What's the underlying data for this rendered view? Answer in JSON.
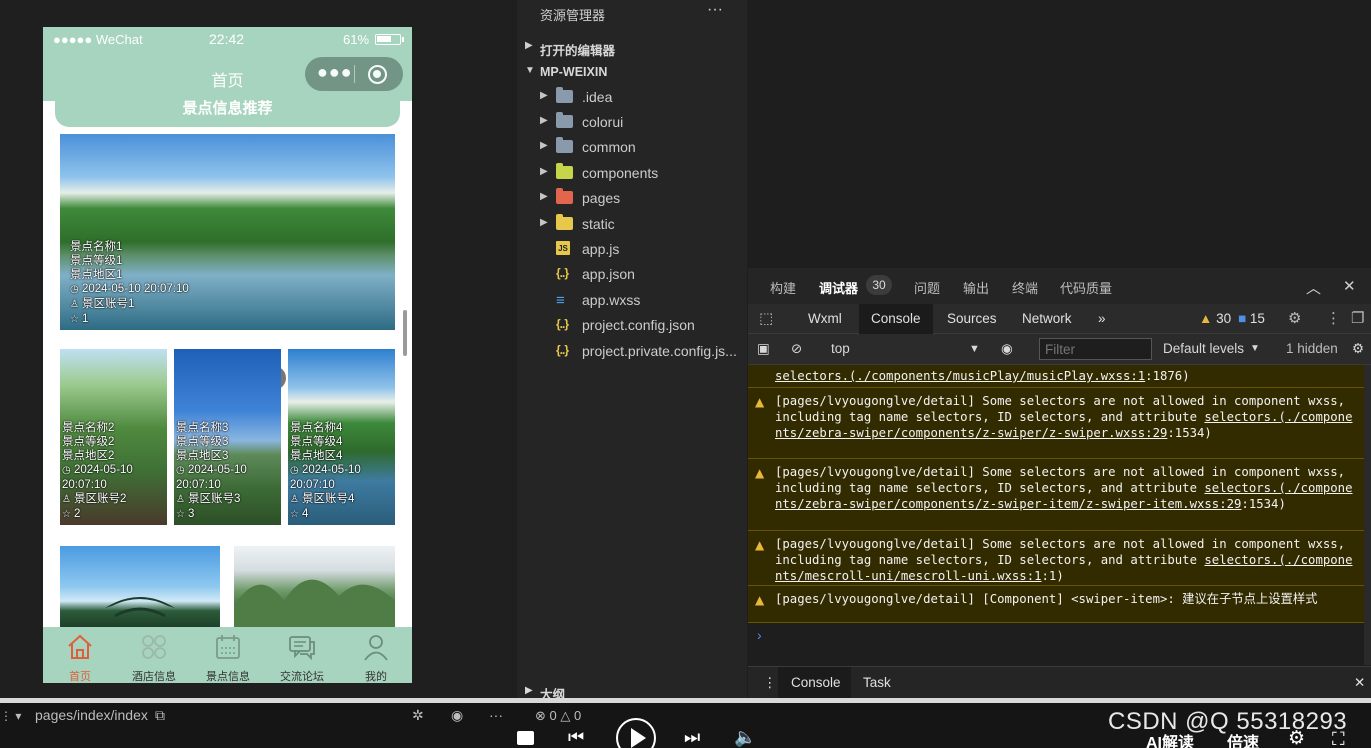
{
  "simulator": {
    "status_bar": {
      "carrier": "●●●●● WeChat",
      "time": "22:42",
      "battery": "61%"
    },
    "nav_title": "首页",
    "section_title": "景点信息推荐",
    "featured": {
      "name": "景点名称1",
      "level": "景点等级1",
      "region": "景点地区1",
      "datetime": "2024-05-10 20:07:10",
      "account": "景区账号1",
      "stars": "1"
    },
    "cards": [
      {
        "name": "景点名称2",
        "level": "景点等级2",
        "region": "景点地区2",
        "date": "2024-05-10",
        "time": "20:07:10",
        "account": "景区账号2",
        "stars": "2"
      },
      {
        "name": "景点名称3",
        "level": "景点等级3",
        "region": "景点地区3",
        "date": "2024-05-10",
        "time": "20:07:10",
        "account": "景区账号3",
        "stars": "3"
      },
      {
        "name": "景点名称4",
        "level": "景点等级4",
        "region": "景点地区4",
        "date": "2024-05-10",
        "time": "20:07:10",
        "account": "景区账号4",
        "stars": "4"
      }
    ],
    "tabs": [
      {
        "label": "首页",
        "icon": "home-icon",
        "active": true
      },
      {
        "label": "酒店信息",
        "icon": "grid-icon",
        "active": false
      },
      {
        "label": "景点信息",
        "icon": "calendar-icon",
        "active": false
      },
      {
        "label": "交流论坛",
        "icon": "chat-icon",
        "active": false
      },
      {
        "label": "我的",
        "icon": "user-icon",
        "active": false
      }
    ],
    "colors": {
      "theme": "#a7d4be",
      "active_tab": "#e05f3b"
    }
  },
  "explorer": {
    "title": "资源管理器",
    "more": "···",
    "open_editors": "打开的编辑器",
    "project": "MP-WEIXIN",
    "outline": "大纲",
    "items": [
      {
        "name": ".idea",
        "type": "folder",
        "icon": "folder-icon"
      },
      {
        "name": "colorui",
        "type": "folder",
        "icon": "folder-icon"
      },
      {
        "name": "common",
        "type": "folder",
        "icon": "folder-icon"
      },
      {
        "name": "components",
        "type": "folder",
        "icon": "components-folder-icon"
      },
      {
        "name": "pages",
        "type": "folder",
        "icon": "pages-folder-icon"
      },
      {
        "name": "static",
        "type": "folder",
        "icon": "static-folder-icon"
      },
      {
        "name": "app.js",
        "type": "file",
        "icon": "js-file-icon"
      },
      {
        "name": "app.json",
        "type": "file",
        "icon": "json-file-icon"
      },
      {
        "name": "app.wxss",
        "type": "file",
        "icon": "css-file-icon"
      },
      {
        "name": "project.config.json",
        "type": "file",
        "icon": "json-file-icon"
      },
      {
        "name": "project.private.config.js...",
        "type": "file",
        "icon": "json-file-icon"
      }
    ]
  },
  "debugger": {
    "tabs": [
      {
        "label": "构建",
        "active": false
      },
      {
        "label": "调试器",
        "active": true
      },
      {
        "label": "问题",
        "active": false
      },
      {
        "label": "输出",
        "active": false
      },
      {
        "label": "终端",
        "active": false
      },
      {
        "label": "代码质量",
        "active": false
      }
    ],
    "badge": "30",
    "devtools_tabs": [
      "Wxml",
      "Console",
      "Sources",
      "Network"
    ],
    "devtools_more": "»",
    "warnings": "30",
    "infos": "15",
    "context": "top",
    "filter_placeholder": "Filter",
    "levels": "Default levels",
    "hidden": "1 hidden",
    "messages": [
      {
        "text": "",
        "link": "selectors.(./components/musicPlay/musicPlay.wxss:1",
        "suffix": ":1876)"
      },
      {
        "text": "[pages/lvyougonglve/detail] Some selectors are not allowed in component wxss, including tag name selectors, ID selectors, and attribute ",
        "link": "selectors.(./components/zebra-swiper/components/z-swiper/z-swiper.wxss:29",
        "suffix": ":1534)"
      },
      {
        "text": "[pages/lvyougonglve/detail] Some selectors are not allowed in component wxss, including tag name selectors, ID selectors, and attribute ",
        "link": "selectors.(./components/zebra-swiper/components/z-swiper-item/z-swiper-item.wxss:29",
        "suffix": ":1534)"
      },
      {
        "text": "[pages/lvyougonglve/detail] Some selectors are not allowed in component wxss, including tag name selectors, ID selectors, and attribute ",
        "link": "selectors.(./components/mescroll-uni/mescroll-uni.wxss:1",
        "suffix": ":1)"
      },
      {
        "text": "[pages/lvyougonglve/detail] [Component] <swiper-item>: 建议在子节点上设置样式",
        "link": "",
        "suffix": ""
      }
    ],
    "prompt": "›",
    "drawer_tabs": [
      "Console",
      "Task"
    ]
  },
  "statusbar": {
    "page_path": "pages/index/index",
    "errors": "0",
    "warnings": "0",
    "watermark": "CSDN @Q  55318293",
    "ai_read": "AI解读",
    "speed": "倍速"
  }
}
